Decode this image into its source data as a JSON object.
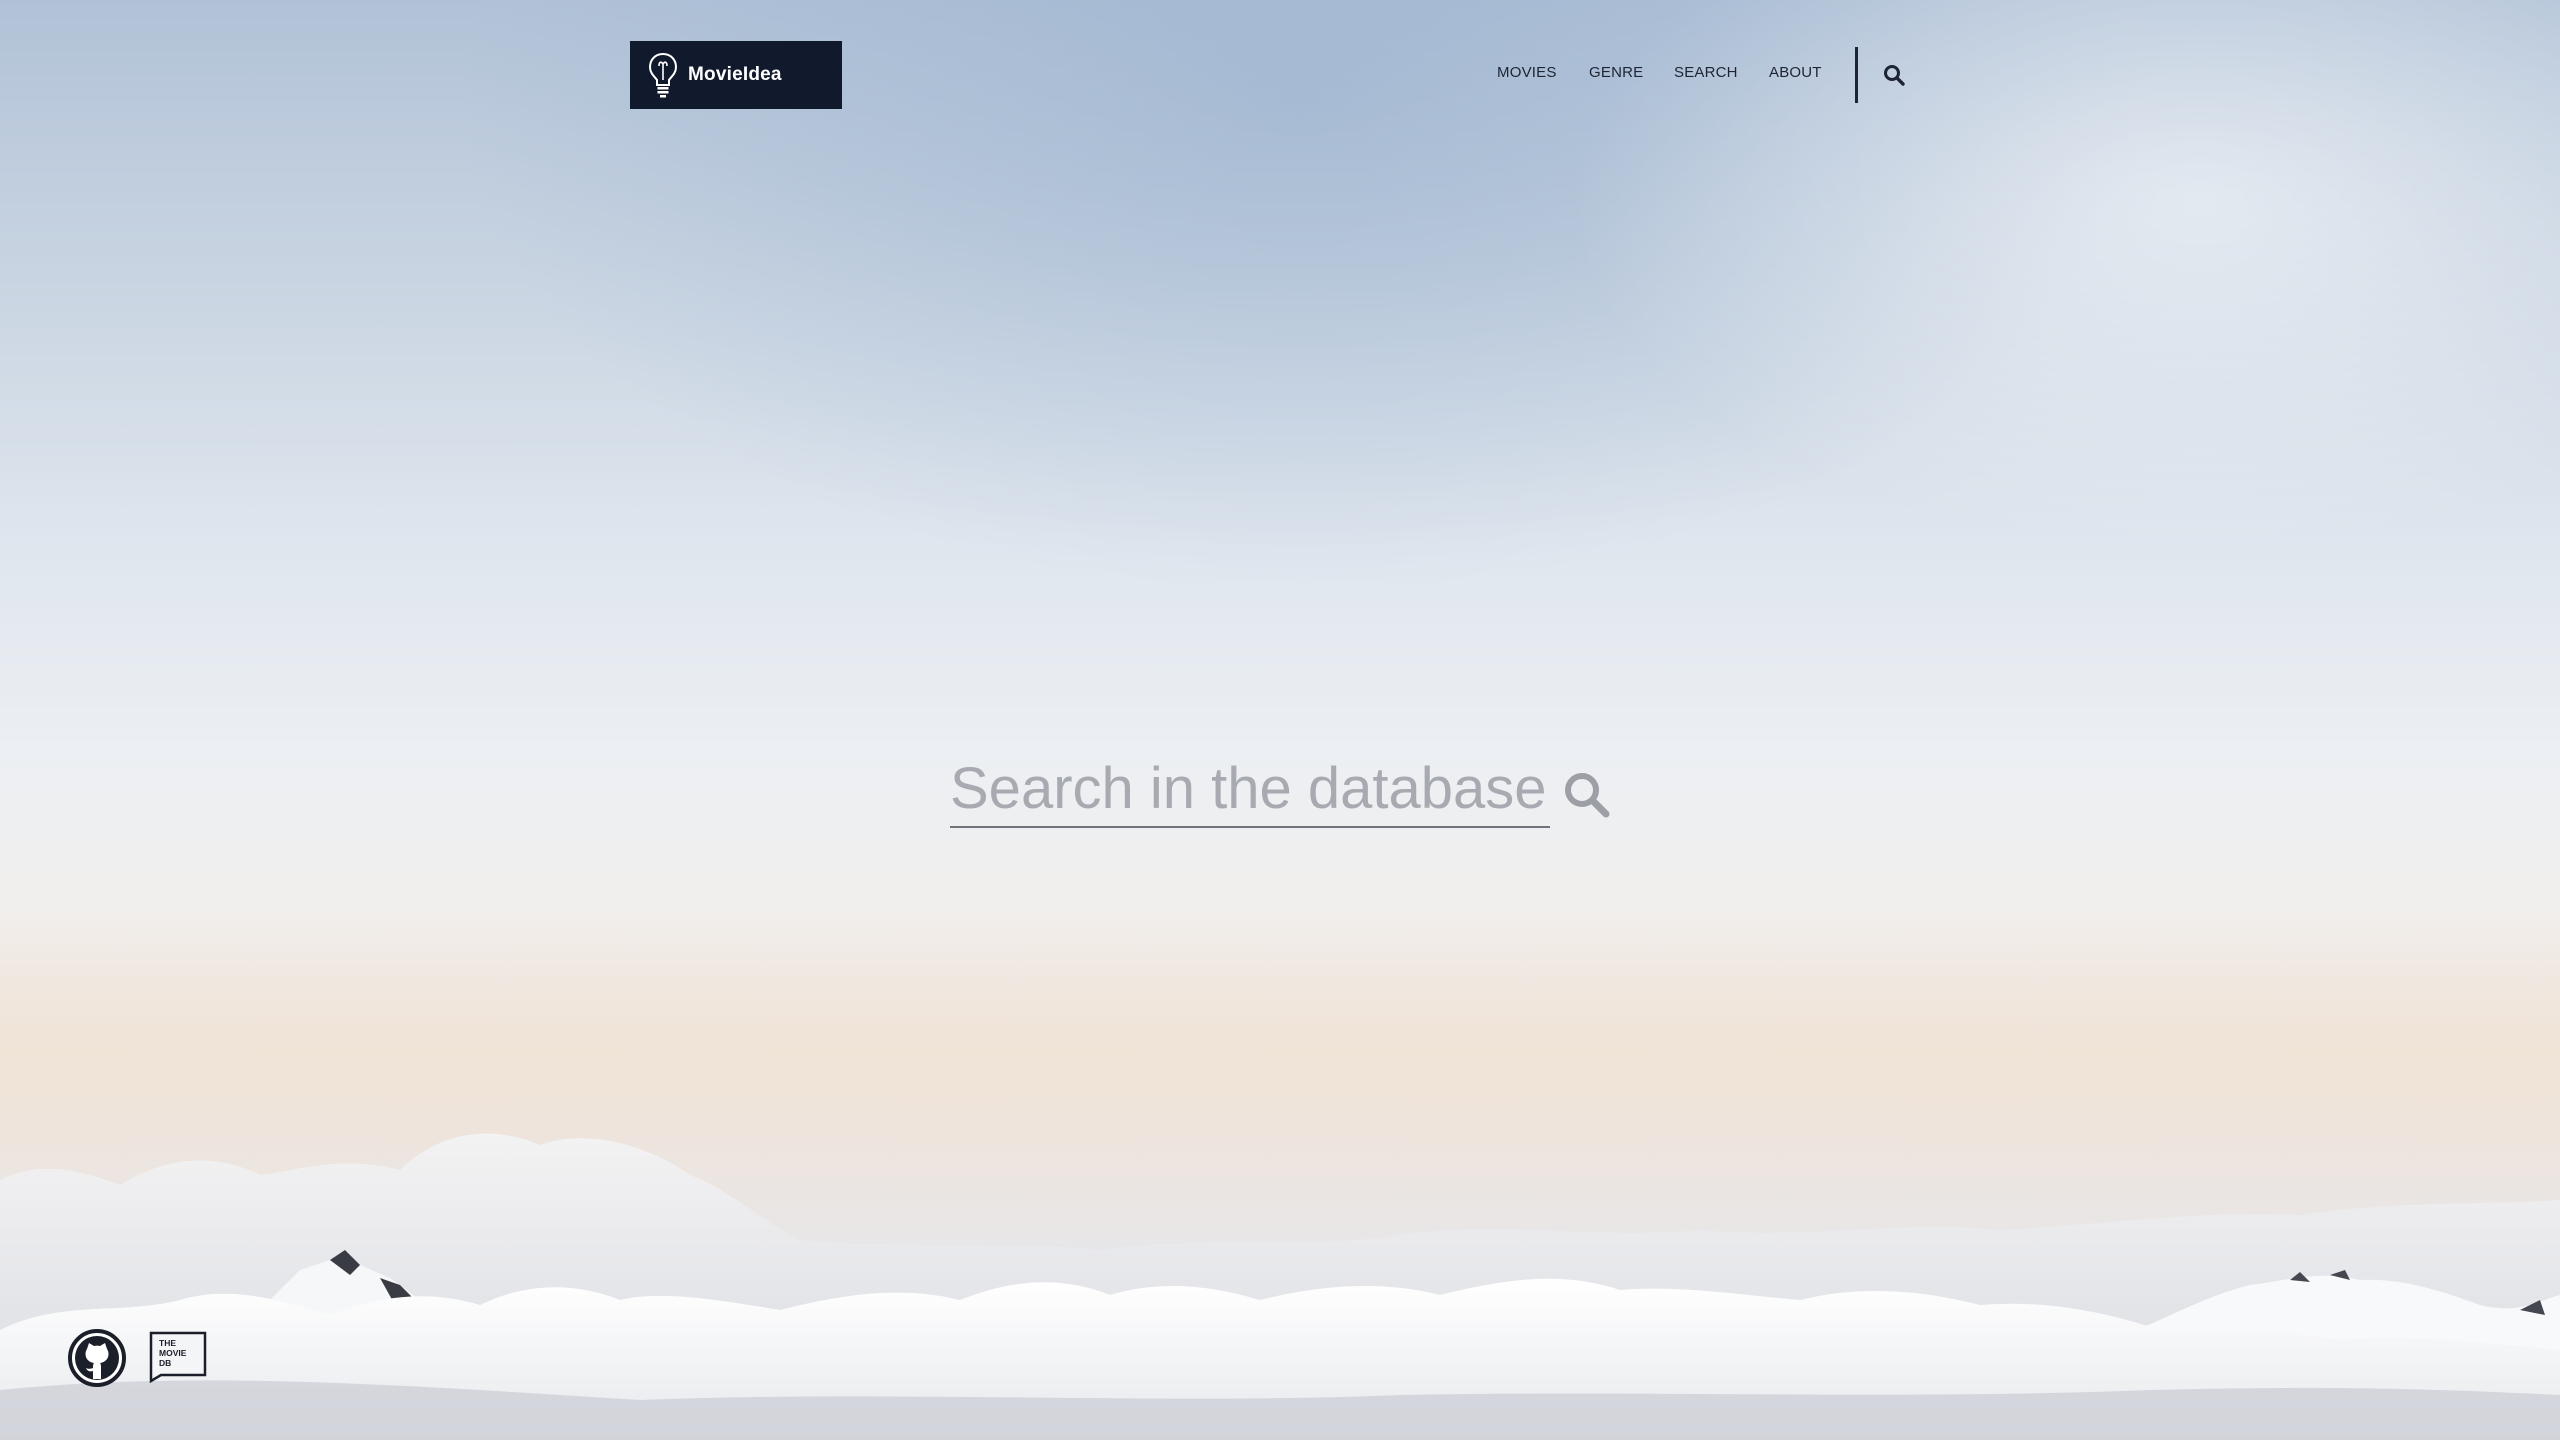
{
  "header": {
    "logo_text": "MovieIdea",
    "nav": [
      {
        "label": "MOVIES"
      },
      {
        "label": "GENRE"
      },
      {
        "label": "SEARCH"
      },
      {
        "label": "ABOUT"
      }
    ],
    "search_icon": "search-icon"
  },
  "search": {
    "placeholder": "Search in the database",
    "value": "",
    "icon": "search-icon"
  },
  "footer": {
    "github_icon": "github-icon",
    "tmdb_logo": "THE MOVIE DB"
  },
  "colors": {
    "logo_background": "#111a2d",
    "nav_text": "#1d2433",
    "placeholder_text": "#a7abb1",
    "sky_top": "#b1c2d7",
    "sky_horizon": "#f1e2d4"
  }
}
